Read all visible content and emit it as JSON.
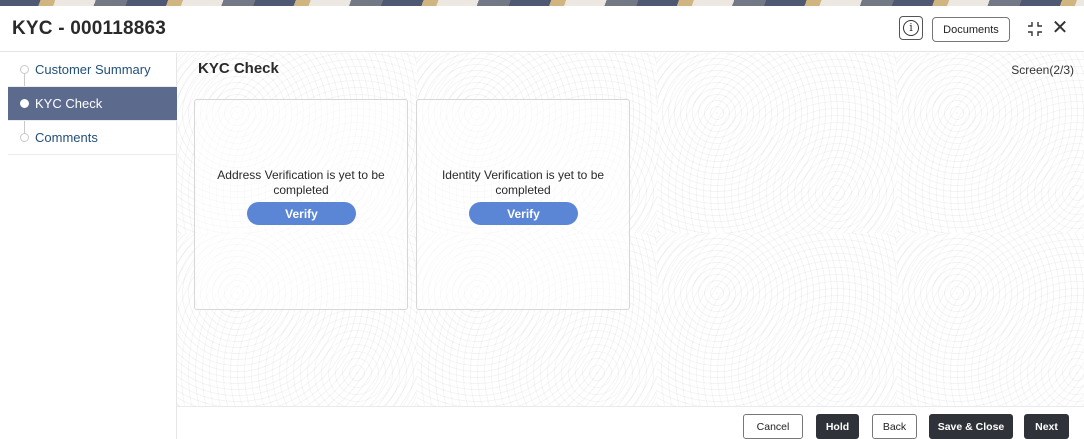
{
  "header": {
    "title": "KYC - 000118863",
    "info_icon_glyph": "i",
    "documents_label": "Documents",
    "close_glyph": "✕"
  },
  "sidebar": {
    "items": [
      {
        "label": "Customer Summary",
        "active": false
      },
      {
        "label": "KYC Check",
        "active": true
      },
      {
        "label": "Comments",
        "active": false
      }
    ]
  },
  "main": {
    "section_title": "KYC Check",
    "screen_indicator": "Screen(2/3)",
    "cards": [
      {
        "message": "Address Verification is yet to be completed",
        "button_label": "Verify"
      },
      {
        "message": "Identity Verification is yet to be completed",
        "button_label": "Verify"
      }
    ]
  },
  "footer": {
    "cancel_label": "Cancel",
    "hold_label": "Hold",
    "back_label": "Back",
    "save_close_label": "Save & Close",
    "next_label": "Next"
  },
  "colors": {
    "active_nav_bg": "#5c6a8e",
    "verify_button_bg": "#5b86d6",
    "dark_button_bg": "#2f3339"
  },
  "icons": {
    "info": "info-icon",
    "collapse": "collapse-icon",
    "close": "close-icon"
  }
}
